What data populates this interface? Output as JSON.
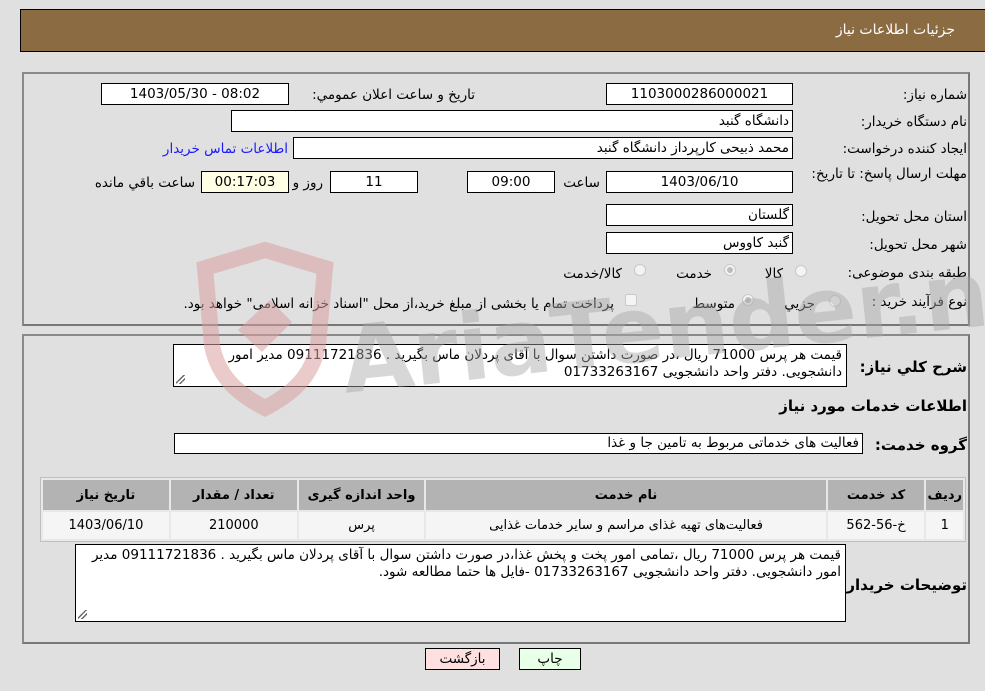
{
  "header": {
    "title": "جزئیات اطلاعات نیاز"
  },
  "form": {
    "need_number": {
      "label": "شماره نیاز:",
      "value": "1103000286000021"
    },
    "announce_datetime": {
      "label": "تاریخ و ساعت اعلان عمومي:",
      "value": "1403/05/30 - 08:02"
    },
    "buyer_org": {
      "label": "نام دستگاه خریدار:",
      "value": "دانشگاه گنبد"
    },
    "requester": {
      "label": "ایجاد کننده درخواست:",
      "value": "محمد ذبیحی کارپرداز دانشگاه گنبد"
    },
    "buyer_contact_link": "اطلاعات تماس خریدار",
    "deadline": {
      "label": "مهلت ارسال پاسخ: تا تاریخ:",
      "date": "1403/06/10",
      "time_label": "ساعت",
      "time": "09:00",
      "days": "11",
      "days_label": "روز و",
      "remaining": "00:17:03",
      "remaining_label": "ساعت باقي مانده"
    },
    "province": {
      "label": "استان محل تحویل:",
      "value": "گلستان"
    },
    "city": {
      "label": "شهر محل تحویل:",
      "value": "گنبد کاووس"
    },
    "category": {
      "label": "طبقه بندی موضوعی:",
      "options": [
        "کالا",
        "خدمت",
        "کالا/خدمت"
      ],
      "selected": "خدمت"
    },
    "purchase_type": {
      "label": "نوع فرآیند خرید :",
      "options": [
        "جزيي",
        "متوسط"
      ],
      "selected": "متوسط",
      "treasury_checkbox_label": "پرداخت تمام یا بخشی از مبلغ خرید،از محل \"اسناد خزانه اسلامی\" خواهد بود.",
      "treasury_checked": false
    }
  },
  "description": {
    "label": "شرح کلي نیاز:",
    "value": "قیمت هر پرس 71000 ریال ،در صورت داشتن سوال با آقای پردلان ماس بگیرید . 09111721836 مدیر امور دانشجویی. دفتر واحد دانشجویی 01733263167"
  },
  "services_section": {
    "title": "اطلاعات خدمات مورد نیاز",
    "group_label": "گروه خدمت:",
    "group_value": "فعالیت های خدماتی مربوط به تامین جا و غذا"
  },
  "table": {
    "headers": [
      "ردیف",
      "کد خدمت",
      "نام خدمت",
      "واحد اندازه گیری",
      "تعداد / مقدار",
      "تاریخ نیاز"
    ],
    "rows": [
      [
        "1",
        "خ-56-562",
        "فعالیت‌های تهیه غذای مراسم و سایر خدمات غذایی",
        "پرس",
        "210000",
        "1403/06/10"
      ]
    ]
  },
  "buyer_notes": {
    "label": "توضیحات خریدار:",
    "value": "قیمت هر پرس 71000 ریال ،تمامی امور پخت و پخش غذا،در صورت داشتن سوال با آقای پردلان ماس بگیرید . 09111721836 مدیر امور دانشجویی. دفتر واحد دانشجویی 01733263167 -فایل ها حتما مطالعه شود."
  },
  "buttons": {
    "print": "چاپ",
    "back": "بازگشت"
  },
  "watermark": {
    "text": "AriaTender.neT",
    "logo_color": "#d9a0a0",
    "text_color": "#a8a8a8"
  }
}
